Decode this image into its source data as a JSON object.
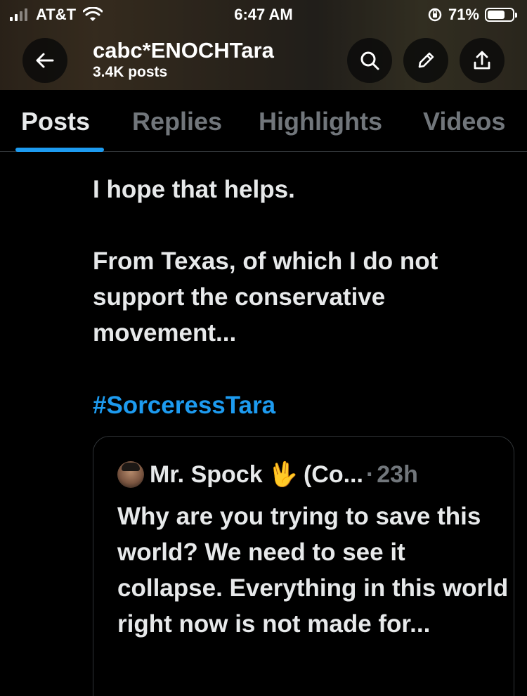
{
  "status_bar": {
    "carrier": "AT&T",
    "time": "6:47 AM",
    "battery": "71%",
    "battery_level": 0.71
  },
  "profile": {
    "name": "cabc*ENOCHTara",
    "posts": "3.4K posts"
  },
  "tabs": [
    {
      "label": "Posts"
    },
    {
      "label": "Replies"
    },
    {
      "label": "Highlights"
    },
    {
      "label": "Videos"
    }
  ],
  "post": {
    "line1": "I hope that helps.",
    "line2": "From Texas, of which I do not support the conservative movement...",
    "hashtag": "#SorceressTara"
  },
  "quote": {
    "author": "Mr. Spock",
    "emoji": "🖖",
    "handle_truncated": "(Co...",
    "separator": "·",
    "time": "23h",
    "text": "Why are you trying to save this world? We need to see it collapse. Everything in this world right now is not made for..."
  },
  "icons": {
    "back": "arrow-left-icon",
    "search": "search-icon",
    "edit": "pencil-icon",
    "share": "share-icon",
    "wifi": "wifi-icon",
    "signal": "signal-icon",
    "orientation_lock": "orientation-lock-icon",
    "battery": "battery-icon"
  },
  "colors": {
    "accent": "#1d9bf0",
    "text": "#e7e9ea",
    "muted": "#71767b",
    "background": "#000000",
    "border": "#2f3336"
  }
}
